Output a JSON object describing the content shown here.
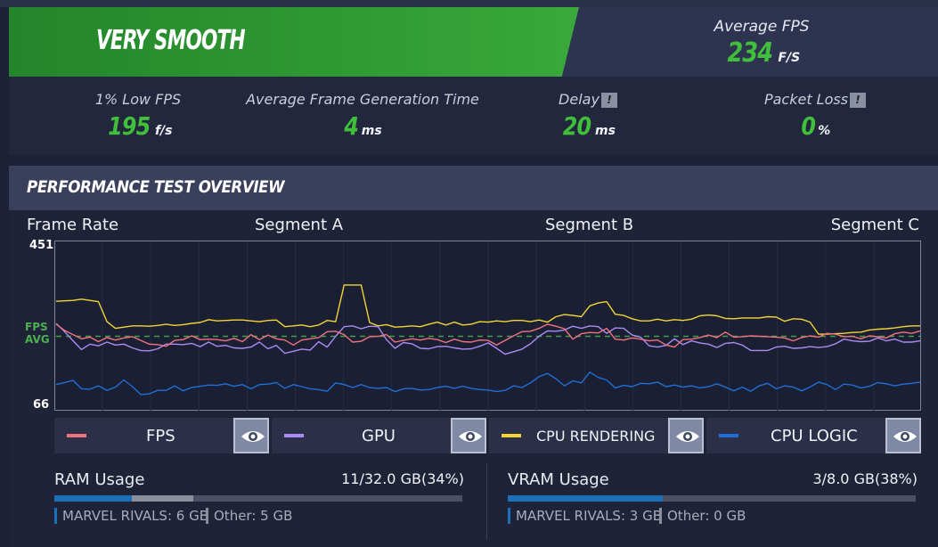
{
  "header": {
    "rating": "VERY SMOOTH",
    "avg_fps_label": "Average FPS",
    "avg_fps_value": "234",
    "avg_fps_unit": "F/S"
  },
  "stats": [
    {
      "label": "1% Low FPS",
      "value": "195",
      "unit": "f/s",
      "info": false
    },
    {
      "label": "Average Frame Generation Time",
      "value": "4",
      "unit": "ms",
      "info": false
    },
    {
      "label": "Delay",
      "value": "20",
      "unit": "ms",
      "info": true
    },
    {
      "label": "Packet Loss",
      "value": "0",
      "unit": "%",
      "info": true
    }
  ],
  "overview_title": "PERFORMANCE TEST OVERVIEW",
  "chart_data": {
    "type": "line",
    "title": "Frame Rate",
    "segments": [
      "Segment A",
      "Segment B",
      "Segment C"
    ],
    "ylim": [
      66,
      451
    ],
    "y_ticks": [
      "451",
      "66"
    ],
    "avg_label": [
      "FPS",
      "AVG"
    ],
    "avg_value": 234,
    "series": [
      {
        "name": "FPS",
        "color": "#f2727f",
        "values": [
          263,
          248,
          238,
          228,
          232,
          221,
          231,
          225,
          230,
          233,
          224,
          215,
          214,
          210,
          224,
          226,
          235,
          226,
          227,
          226,
          223,
          229,
          221,
          238,
          226,
          237,
          228,
          225,
          213,
          225,
          228,
          231,
          245,
          246,
          238,
          220,
          222,
          233,
          234,
          238,
          220,
          224,
          228,
          225,
          229,
          226,
          219,
          227,
          221,
          220,
          225,
          224,
          213,
          224,
          235,
          245,
          246,
          253,
          263,
          258,
          252,
          227,
          240,
          243,
          242,
          253,
          227,
          225,
          230,
          227,
          223,
          225,
          213,
          208,
          226,
          227,
          231,
          237,
          231,
          244,
          232,
          233,
          235,
          234,
          233,
          232,
          230,
          223,
          231,
          235,
          232,
          241,
          239,
          233,
          234,
          228,
          235,
          233,
          230,
          240,
          244,
          241,
          247
        ]
      },
      {
        "name": "GPU",
        "color": "#a98cf2",
        "values": [
          265,
          245,
          223,
          202,
          215,
          211,
          220,
          213,
          215,
          206,
          200,
          199,
          204,
          215,
          215,
          214,
          217,
          209,
          220,
          210,
          212,
          206,
          205,
          208,
          220,
          204,
          212,
          193,
          198,
          203,
          201,
          221,
          208,
          234,
          257,
          259,
          252,
          258,
          257,
          226,
          205,
          219,
          216,
          205,
          204,
          209,
          210,
          206,
          203,
          204,
          210,
          218,
          205,
          191,
          197,
          203,
          216,
          234,
          247,
          246,
          249,
          258,
          253,
          259,
          257,
          241,
          254,
          253,
          237,
          232,
          211,
          208,
          212,
          228,
          214,
          223,
          218,
          215,
          207,
          217,
          219,
          213,
          200,
          200,
          200,
          208,
          210,
          205,
          206,
          209,
          207,
          209,
          216,
          227,
          223,
          221,
          222,
          230,
          223,
          227,
          220,
          220,
          223
        ]
      },
      {
        "name": "CPU RENDERING",
        "color": "#f2d535",
        "values": [
          318,
          319,
          320,
          323,
          320,
          317,
          269,
          253,
          256,
          259,
          259,
          258,
          260,
          263,
          260,
          262,
          265,
          267,
          274,
          271,
          272,
          273,
          273,
          271,
          269,
          272,
          273,
          257,
          259,
          261,
          257,
          261,
          272,
          269,
          357,
          357,
          357,
          267,
          259,
          262,
          256,
          257,
          259,
          257,
          263,
          268,
          261,
          268,
          261,
          263,
          269,
          268,
          271,
          269,
          272,
          272,
          269,
          273,
          268,
          281,
          286,
          284,
          281,
          307,
          314,
          317,
          287,
          284,
          276,
          271,
          271,
          275,
          271,
          274,
          272,
          275,
          283,
          285,
          283,
          277,
          276,
          278,
          278,
          278,
          281,
          280,
          270,
          276,
          275,
          268,
          239,
          239,
          240,
          241,
          243,
          244,
          249,
          251,
          252,
          254,
          257,
          259,
          259
        ]
      },
      {
        "name": "CPU LOGIC",
        "color": "#1f6fd6",
        "values": [
          118,
          123,
          128,
          108,
          107,
          115,
          104,
          112,
          129,
          113,
          94,
          96,
          104,
          104,
          115,
          103,
          111,
          114,
          117,
          116,
          120,
          114,
          118,
          108,
          118,
          119,
          123,
          109,
          118,
          113,
          108,
          106,
          102,
          122,
          118,
          111,
          118,
          111,
          109,
          111,
          101,
          108,
          109,
          105,
          106,
          111,
          114,
          109,
          114,
          109,
          106,
          105,
          101,
          104,
          115,
          111,
          122,
          137,
          145,
          132,
          115,
          127,
          122,
          148,
          135,
          129,
          110,
          116,
          113,
          121,
          120,
          124,
          113,
          117,
          112,
          115,
          110,
          113,
          120,
          112,
          103,
          112,
          102,
          115,
          121,
          108,
          115,
          112,
          103,
          112,
          124,
          118,
          106,
          119,
          117,
          110,
          114,
          123,
          120,
          115,
          119,
          121,
          124
        ]
      }
    ]
  },
  "legend": {
    "items": [
      {
        "label": "FPS",
        "color": "#f2727f"
      },
      {
        "label": "GPU",
        "color": "#a98cf2"
      },
      {
        "label": "CPU RENDERING",
        "color": "#f2d535"
      },
      {
        "label": "CPU LOGIC",
        "color": "#1f6fd6"
      }
    ],
    "eye_icon": "eye-icon"
  },
  "ram": {
    "title": "RAM Usage",
    "amount": "11/32.0 GB(34%)",
    "app_fraction": 0.19,
    "other_fraction": 0.15,
    "app_label": "MARVEL RIVALS: 6 GB",
    "other_label": "Other: 5 GB"
  },
  "vram": {
    "title": "VRAM Usage",
    "amount": "3/8.0 GB(38%)",
    "app_fraction": 0.38,
    "other_fraction": 0.0,
    "app_label": "MARVEL RIVALS: 3 GB",
    "other_label": "Other: 0 GB"
  }
}
